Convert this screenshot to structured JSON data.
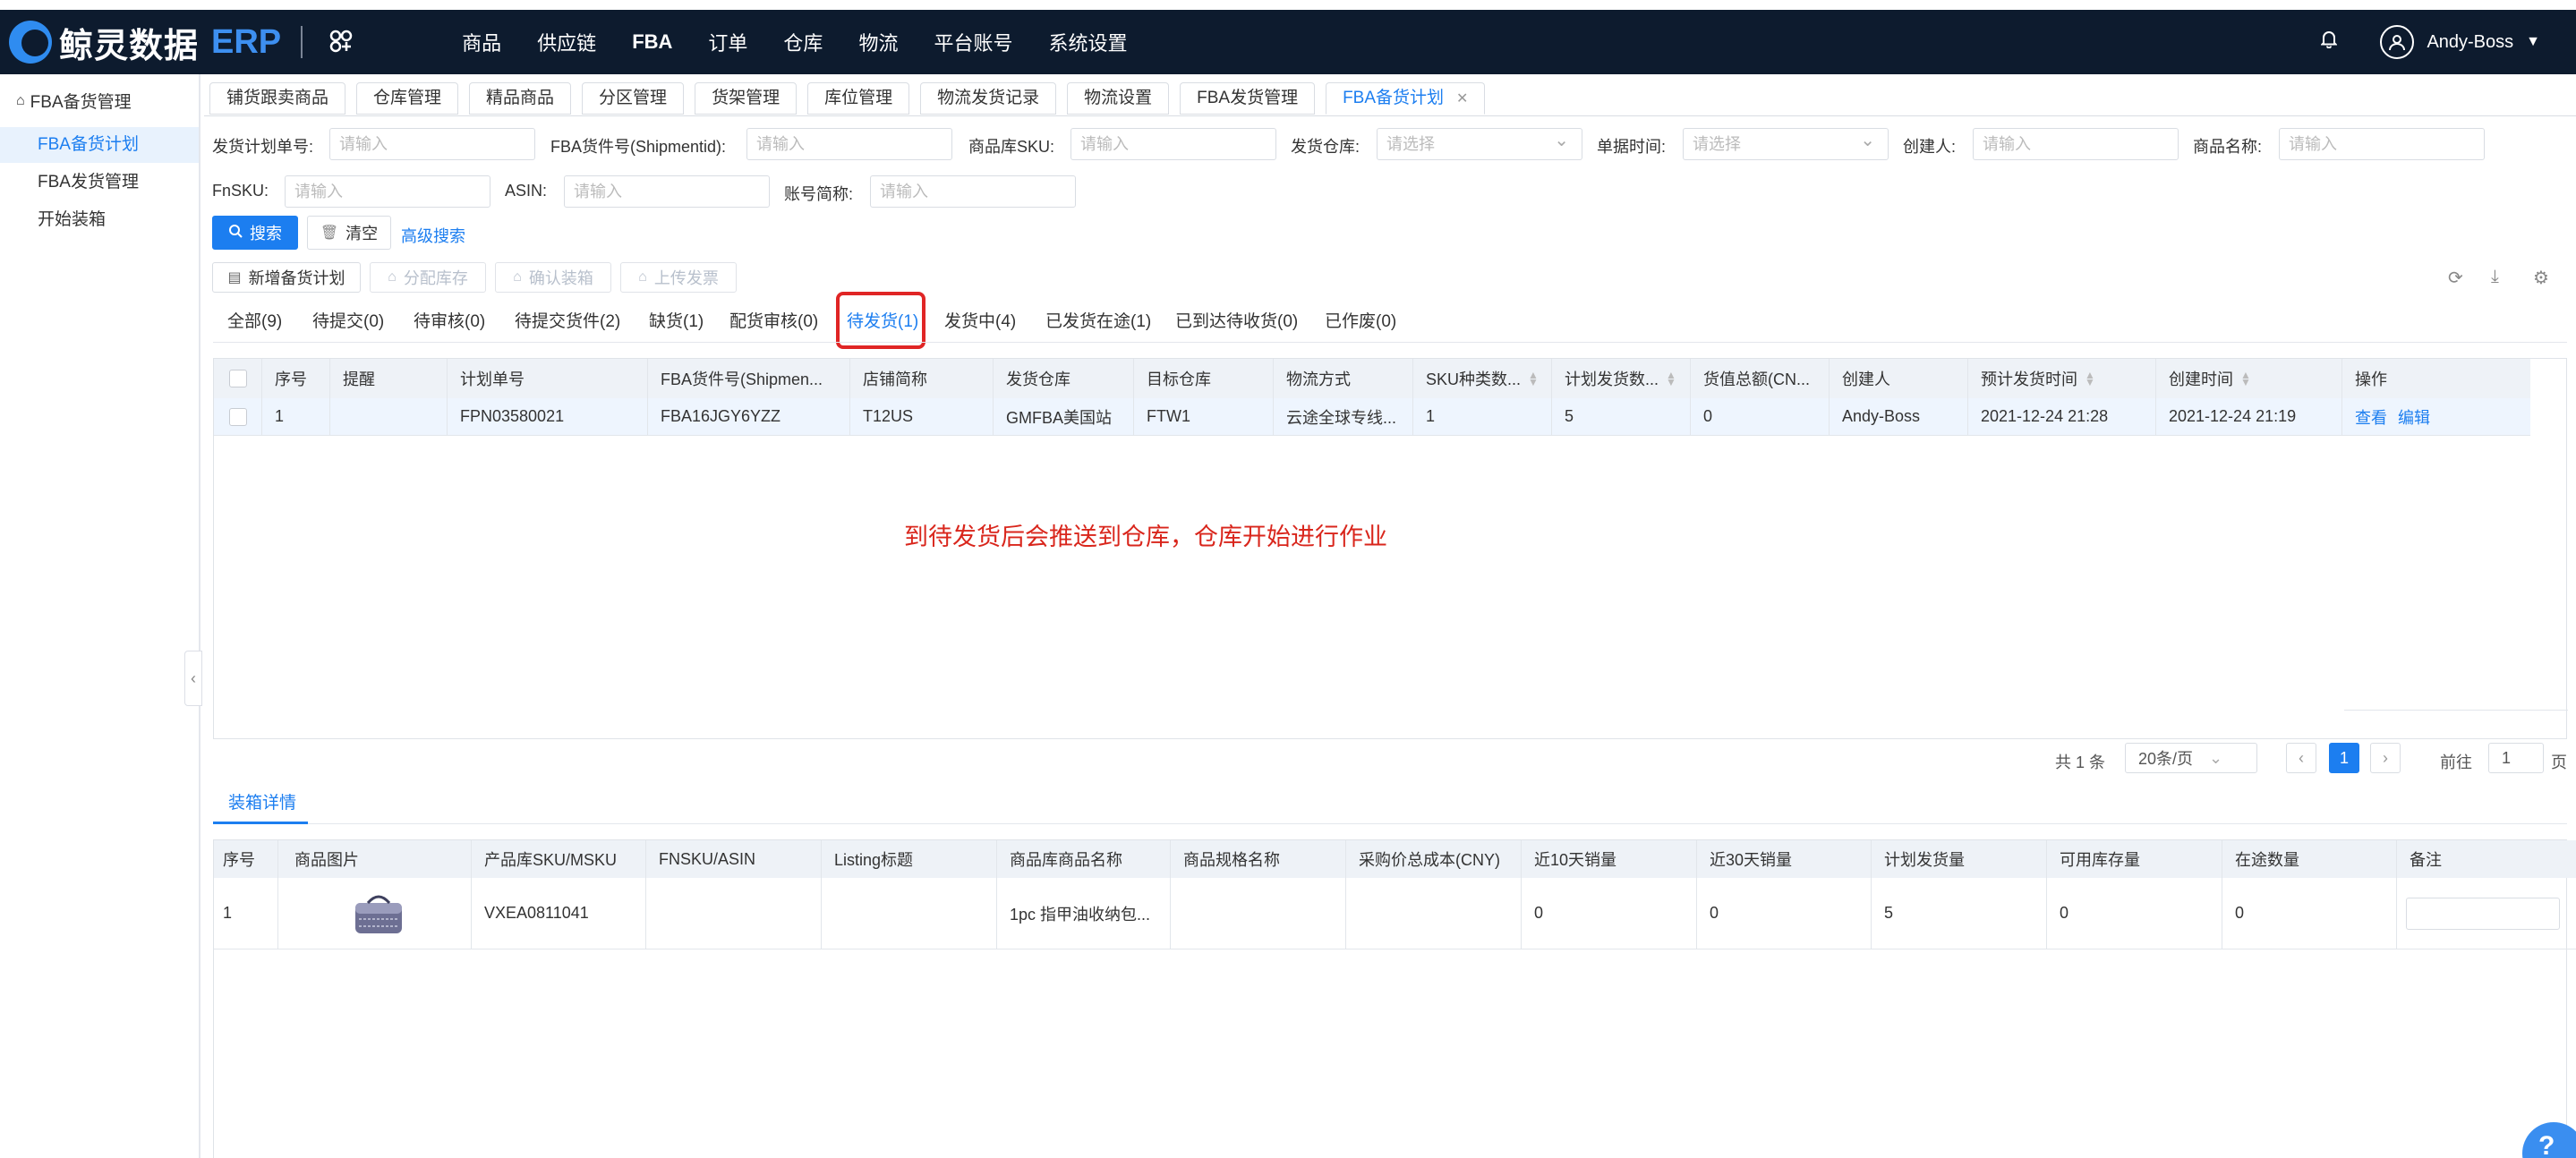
{
  "brand": {
    "name": "鲸灵数据",
    "suffix": "ERP"
  },
  "nav": {
    "items": [
      "商品",
      "供应链",
      "FBA",
      "订单",
      "仓库",
      "物流",
      "平台账号",
      "系统设置"
    ],
    "active": "FBA"
  },
  "user": {
    "name": "Andy-Boss"
  },
  "sidebar": {
    "group": "FBA备货管理",
    "items": [
      "FBA备货计划",
      "FBA发货管理",
      "开始装箱"
    ],
    "active": "FBA备货计划"
  },
  "tabs": [
    "铺货跟卖商品",
    "仓库管理",
    "精品商品",
    "分区管理",
    "货架管理",
    "库位管理",
    "物流发货记录",
    "物流设置",
    "FBA发货管理",
    "FBA备货计划"
  ],
  "filters": {
    "plan_no": {
      "label": "发货计划单号:",
      "placeholder": "请输入"
    },
    "shipment_id": {
      "label": "FBA货件号(Shipmentid):",
      "placeholder": "请输入"
    },
    "sku": {
      "label": "商品库SKU:",
      "placeholder": "请输入"
    },
    "warehouse": {
      "label": "发货仓库:",
      "placeholder": "请选择"
    },
    "date": {
      "label": "单据时间:",
      "placeholder": "请选择"
    },
    "creator": {
      "label": "创建人:",
      "placeholder": "请输入"
    },
    "product_name": {
      "label": "商品名称:",
      "placeholder": "请输入"
    },
    "fnsku": {
      "label": "FnSKU:",
      "placeholder": "请输入"
    },
    "asin": {
      "label": "ASIN:",
      "placeholder": "请输入"
    },
    "account": {
      "label": "账号简称:",
      "placeholder": "请输入"
    }
  },
  "buttons": {
    "search": "搜索",
    "clear": "清空",
    "advanced": "高级搜索",
    "new_plan": "新增备货计划",
    "allocate": "分配库存",
    "confirm_box": "确认装箱",
    "upload_invoice": "上传发票"
  },
  "status_tabs": [
    "全部(9)",
    "待提交(0)",
    "待审核(0)",
    "待提交货件(2)",
    "缺货(1)",
    "配货审核(0)",
    "待发货(1)",
    "发货中(4)",
    "已发货在途(1)",
    "已到达待收货(0)",
    "已作废(0)"
  ],
  "status_active": "待发货(1)",
  "plan_table": {
    "headers": [
      "序号",
      "提醒",
      "计划单号",
      "FBA货件号(Shipmen...",
      "店铺简称",
      "发货仓库",
      "目标仓库",
      "物流方式",
      "SKU种类数...",
      "计划发货数...",
      "货值总额(CN...",
      "创建人",
      "预计发货时间",
      "创建时间",
      "操作"
    ],
    "rows": [
      {
        "index": "1",
        "remind": "",
        "plan_no": "FPN03580021",
        "shipment": "FBA16JGY6YZZ",
        "store": "T12US",
        "warehouse": "GMFBA美国站",
        "target": "FTW1",
        "logistics": "云途全球专线...",
        "sku_count": "1",
        "plan_qty": "5",
        "value": "0",
        "creator": "Andy-Boss",
        "est_time": "2021-12-24 21:28",
        "created": "2021-12-24 21:19",
        "op_view": "查看",
        "op_edit": "编辑"
      }
    ]
  },
  "annotation": "到待发货后会推送到仓库，仓库开始进行作业",
  "pagination": {
    "total": "共 1 条",
    "page_size": "20条/页",
    "current": "1",
    "goto_label": "前往",
    "goto_value": "1",
    "page_suffix": "页"
  },
  "detail": {
    "tab": "装箱详情",
    "headers": [
      "序号",
      "商品图片",
      "产品库SKU/MSKU",
      "FNSKU/ASIN",
      "Listing标题",
      "商品库商品名称",
      "商品规格名称",
      "采购价总成本(CNY)",
      "近10天销量",
      "近30天销量",
      "计划发货量",
      "可用库存量",
      "在途数量",
      "备注"
    ],
    "rows": [
      {
        "index": "1",
        "sku": "VXEA0811041",
        "fnsku": "",
        "listing": "",
        "name": "1pc 指甲油收纳包...",
        "spec": "",
        "cost": "",
        "sales10": "0",
        "sales30": "0",
        "plan_qty": "5",
        "available": "0",
        "transit": "0"
      }
    ]
  },
  "colors": {
    "primary": "#1c7ef0",
    "topbar": "#0d1b2e",
    "annotation": "#d9261c"
  }
}
